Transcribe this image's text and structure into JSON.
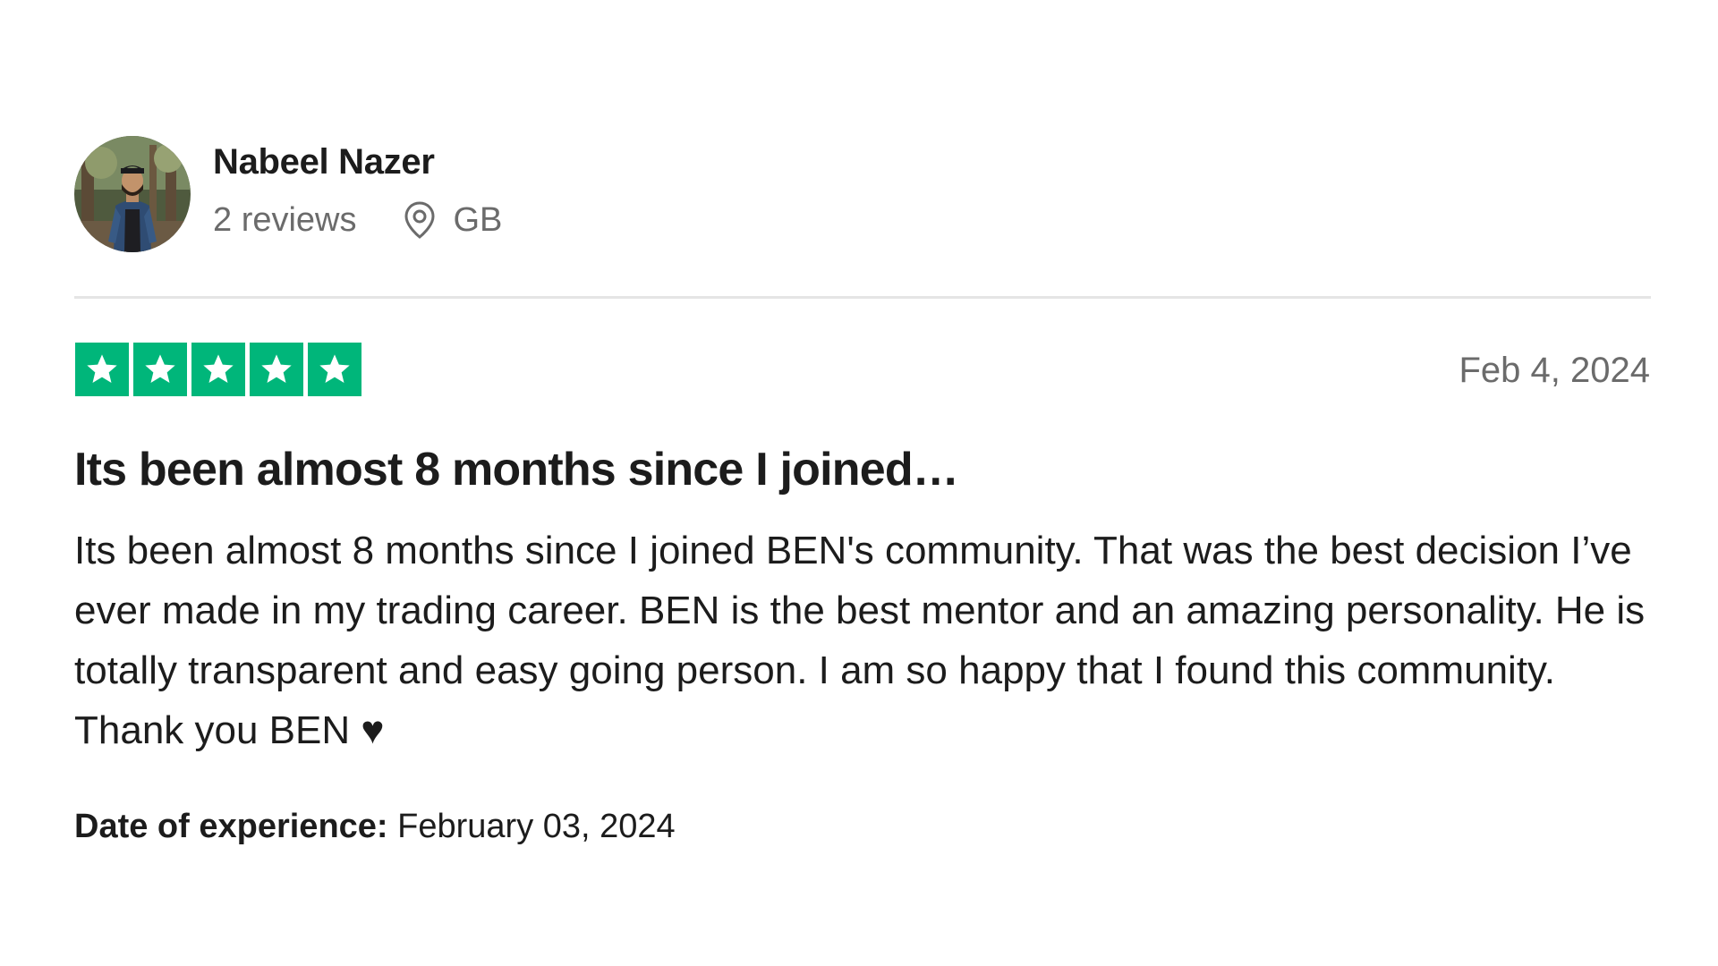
{
  "reviewer": {
    "name": "Nabeel Nazer",
    "review_count": "2 reviews",
    "location": "GB",
    "location_icon": "location-pin-icon",
    "avatar": "reviewer-photo"
  },
  "rating": {
    "stars": 5,
    "max": 5,
    "star_color": "#00b67a",
    "star_icon": "star-icon"
  },
  "review": {
    "date": "Feb 4, 2024",
    "title": "Its been almost 8 months since I joined…",
    "body": "Its been almost 8 months since I joined BEN's community. That was the best decision I’ve ever made in my trading career. BEN is the best mentor and an amazing personality. He is totally transparent and easy going person. I am so happy that I found this community. Thank you BEN ♥"
  },
  "experience": {
    "label": "Date of experience:",
    "date": "February 03, 2024"
  }
}
